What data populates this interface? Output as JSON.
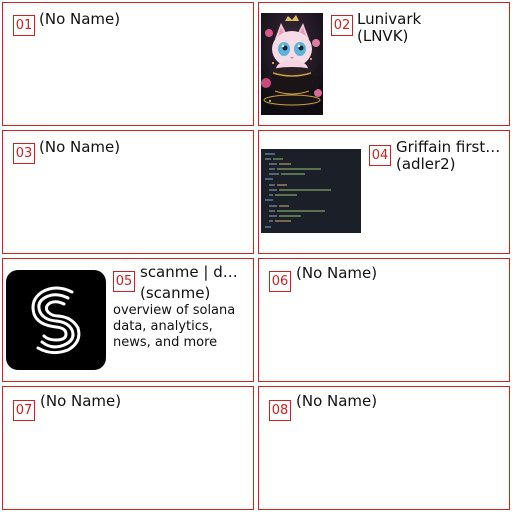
{
  "colors": {
    "border": "#cc2222",
    "badge_text": "#cc2222",
    "text": "#111111",
    "logo_bg": "#000000",
    "code_bg": "#1b1f27"
  },
  "cards": [
    {
      "index": "01",
      "title": "(No Name)"
    },
    {
      "index": "02",
      "title": "Lunivark",
      "subtitle": "(LNVK)",
      "thumbnail_icon": "kitten-in-teacup-image"
    },
    {
      "index": "03",
      "title": "(No Name)"
    },
    {
      "index": "04",
      "title": "Griffain first…",
      "subtitle": "(adler2)",
      "thumbnail_icon": "code-screenshot-image"
    },
    {
      "index": "05",
      "title": "scanme | d…",
      "subtitle": "(scanme)",
      "description": "overview of solana data, analytics, news, and more",
      "thumbnail_icon": "scanme-logo-icon"
    },
    {
      "index": "06",
      "title": "(No Name)"
    },
    {
      "index": "07",
      "title": "(No Name)"
    },
    {
      "index": "08",
      "title": "(No Name)"
    }
  ]
}
